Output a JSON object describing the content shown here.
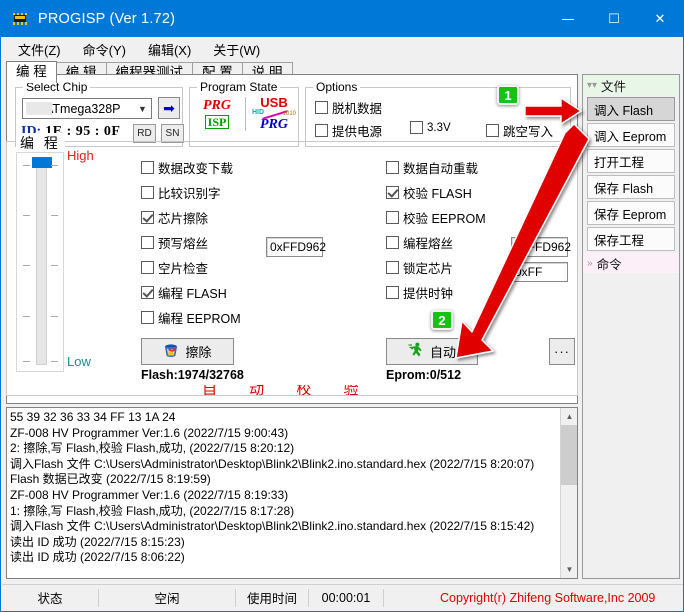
{
  "window": {
    "title": "PROGISP (Ver 1.72)",
    "icon": "chip-icon",
    "minimize": "—",
    "maximize": "☐",
    "close": "✕"
  },
  "menubar": {
    "items": [
      {
        "label": "文件(Z)",
        "name": "menu-file"
      },
      {
        "label": "命令(Y)",
        "name": "menu-command"
      },
      {
        "label": "编辑(X)",
        "name": "menu-edit"
      },
      {
        "label": "关于(W)",
        "name": "menu-about"
      }
    ]
  },
  "tabs": [
    {
      "label": "编 程",
      "active": true
    },
    {
      "label": "编 辑",
      "active": false
    },
    {
      "label": "编程器测试",
      "active": false
    },
    {
      "label": "配 置",
      "active": false
    },
    {
      "label": "说 明",
      "active": false
    }
  ],
  "select_chip": {
    "legend": "Select Chip",
    "chip_value": "ATmega328P",
    "go_arrow": "➡",
    "id_label": "ID:",
    "id_value": "1E : 95 : 0F",
    "rd_button": "RD",
    "sn_button": "SN"
  },
  "program_state": {
    "legend": "Program State",
    "left_top": "PRG",
    "left_bottom": "ISP",
    "right_top": "USB",
    "right_mid_left": "HID",
    "right_mid_right": "1010",
    "right_bottom": "PRG"
  },
  "options": {
    "legend": "Options",
    "items": [
      {
        "label": "脱机数据",
        "checked": false,
        "name": "option-offline-data"
      },
      {
        "label": "提供电源",
        "checked": false,
        "name": "option-provide-power"
      },
      {
        "label": "3.3V",
        "checked": false,
        "name": "option-3v3"
      },
      {
        "label": "跳空写入",
        "checked": false,
        "name": "option-skip-blank-write"
      }
    ]
  },
  "program_group": {
    "legend": "编 程",
    "slider": {
      "high_label": "High",
      "low_label": "Low",
      "value_percent": 97
    },
    "left_checks": [
      {
        "label": "数据改变下载",
        "checked": false,
        "name": "check-download-on-data-change"
      },
      {
        "label": "比较识别字",
        "checked": false,
        "name": "check-compare-signature"
      },
      {
        "label": "芯片擦除",
        "checked": true,
        "name": "check-chip-erase"
      },
      {
        "label": "预写熔丝",
        "checked": false,
        "name": "check-prewrite-fuse"
      },
      {
        "label": "空片检查",
        "checked": false,
        "name": "check-blank-check"
      },
      {
        "label": "编程 FLASH",
        "checked": true,
        "name": "check-program-flash"
      },
      {
        "label": "编程 EEPROM",
        "checked": false,
        "name": "check-program-eeprom"
      }
    ],
    "right_checks": [
      {
        "label": "数据自动重载",
        "checked": false,
        "name": "check-auto-reload-data"
      },
      {
        "label": "校验 FLASH",
        "checked": true,
        "name": "check-verify-flash"
      },
      {
        "label": "校验 EEPROM",
        "checked": false,
        "name": "check-verify-eeprom"
      },
      {
        "label": "编程熔丝",
        "checked": false,
        "name": "check-program-fuse"
      },
      {
        "label": "锁定芯片",
        "checked": false,
        "name": "check-lock-chip"
      },
      {
        "label": "提供时钟",
        "checked": false,
        "name": "check-provide-clock"
      }
    ],
    "hex_prewrite_fuse": "0xFFD962",
    "hex_program_fuse": "0xFFD962",
    "hex_lock": "0xFF",
    "erase_button": "擦除",
    "auto_button": "自动",
    "more_button": "···",
    "flash_usage": "Flash:1974/32768",
    "eprom_usage": "Eprom:0/512",
    "watermark": "自 动 校 验"
  },
  "log": {
    "lines": [
      "55 39 32 36 33 34 FF 13 1A 24",
      "ZF-008 HV Programmer Ver:1.6 (2022/7/15 9:00:43)",
      "2: 擦除,写 Flash,校验 Flash,成功, (2022/7/15 8:20:12)",
      "调入Flash 文件 C:\\Users\\Administrator\\Desktop\\Blink2\\Blink2.ino.standard.hex (2022/7/15 8:20:07)",
      "Flash 数据已改变 (2022/7/15 8:19:59)",
      "ZF-008 HV Programmer Ver:1.6 (2022/7/15 8:19:33)",
      "1: 擦除,写 Flash,校验 Flash,成功, (2022/7/15 8:17:28)",
      "调入Flash 文件 C:\\Users\\Administrator\\Desktop\\Blink2\\Blink2.ino.standard.hex (2022/7/15 8:15:42)",
      "读出 ID 成功 (2022/7/15 8:15:23)",
      "读出 ID 成功 (2022/7/15 8:06:22)"
    ]
  },
  "sidebar": {
    "files_header": "文件",
    "commands_header": "命令",
    "file_buttons": [
      {
        "label": "调入 Flash",
        "selected": true,
        "name": "sidebar-load-flash"
      },
      {
        "label": "调入 Eeprom",
        "selected": false,
        "name": "sidebar-load-eeprom"
      },
      {
        "label": "打开工程",
        "selected": false,
        "name": "sidebar-open-project"
      },
      {
        "label": "保存 Flash",
        "selected": false,
        "name": "sidebar-save-flash"
      },
      {
        "label": "保存 Eeprom",
        "selected": false,
        "name": "sidebar-save-eeprom"
      },
      {
        "label": "保存工程",
        "selected": false,
        "name": "sidebar-save-project"
      }
    ]
  },
  "statusbar": {
    "state_label": "状态",
    "state_value": "空闲",
    "time_label": "使用时间",
    "time_value": "00:00:01",
    "copyright": "Copyright(r) Zhifeng Software,Inc 2009"
  },
  "annotations": {
    "badge1": "1",
    "badge2": "2",
    "arrow_color": "#e00000",
    "badge_color": "#17c217"
  }
}
